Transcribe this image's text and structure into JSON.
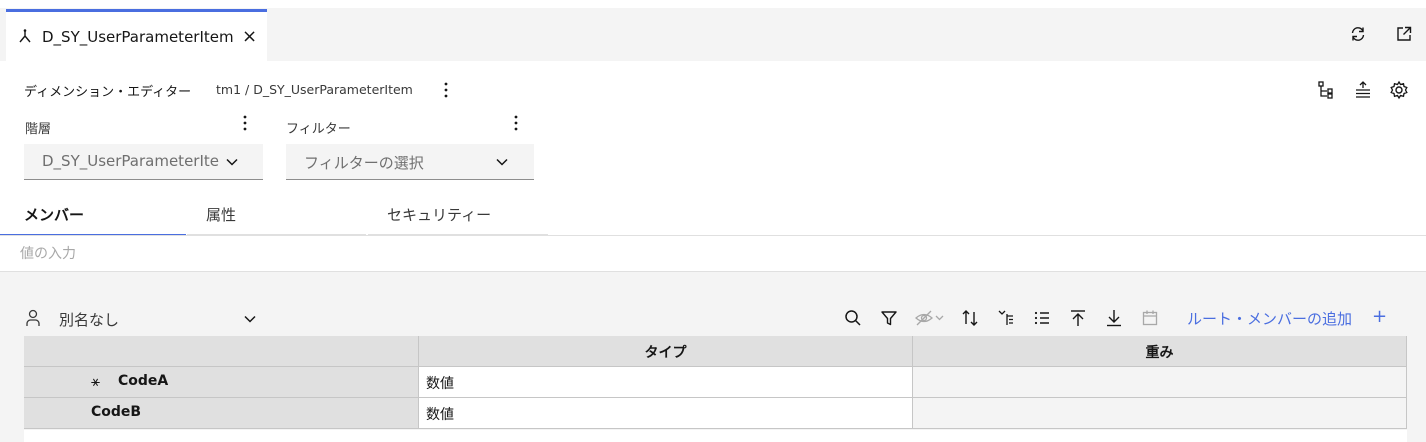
{
  "tab": {
    "title": "D_SY_UserParameterItem",
    "close": "×"
  },
  "editor": {
    "title": "ディメンション・エディター",
    "path": "tm1 / D_SY_UserParameterItem"
  },
  "hierarchy": {
    "label": "階層",
    "value": "D_SY_UserParameterIte"
  },
  "filter": {
    "label": "フィルター",
    "value": "フィルターの選択"
  },
  "tabs": [
    {
      "label": "メンバー",
      "active": true
    },
    {
      "label": "属性",
      "active": false
    },
    {
      "label": "セキュリティー",
      "active": false
    }
  ],
  "value_input": {
    "placeholder": "値の入力"
  },
  "alias": {
    "label": "別名なし"
  },
  "toolbar": {
    "add_root_label": "ルート・メンバーの追加",
    "add_icon": "+"
  },
  "grid": {
    "columns": [
      "",
      "タイプ",
      "重み"
    ],
    "rows": [
      {
        "name": "CodeA",
        "marker": "⚹",
        "type": "数値",
        "weight": ""
      },
      {
        "name": "CodeB",
        "marker": "",
        "type": "数値",
        "weight": ""
      }
    ]
  },
  "colors": {
    "accent": "#4a6ee0",
    "panel": "#f4f4f4",
    "header": "#e0e0e0"
  }
}
